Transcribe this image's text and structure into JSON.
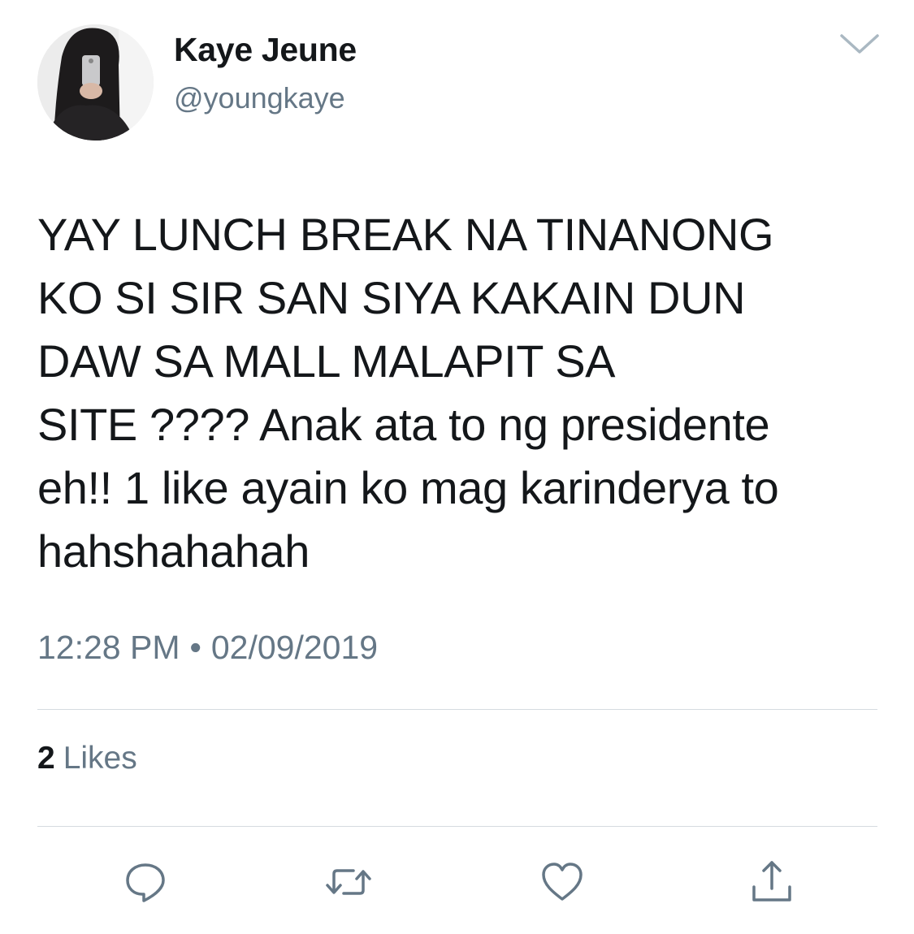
{
  "user": {
    "display_name": "Kaye Jeune",
    "handle": "@youngkaye"
  },
  "tweet": {
    "text": "YAY LUNCH BREAK NA TINANONG\nKO SI SIR SAN SIYA KAKAIN DUN\nDAW SA MALL MALAPIT SA\nSITE ???? Anak ata to ng presidente\neh!! 1 like ayain ko mag karinderya to\nhahshahahah",
    "time": "12:28 PM",
    "separator": "•",
    "date": "02/09/2019"
  },
  "stats": {
    "likes_count": "2",
    "likes_label": "Likes"
  },
  "icons": {
    "menu": "chevron-down-icon",
    "reply": "reply-icon",
    "retweet": "retweet-icon",
    "like": "heart-icon",
    "share": "share-icon"
  },
  "colors": {
    "text_primary": "#14171a",
    "text_secondary": "#657786",
    "icon": "#657786",
    "divider": "#d5dbe0"
  }
}
